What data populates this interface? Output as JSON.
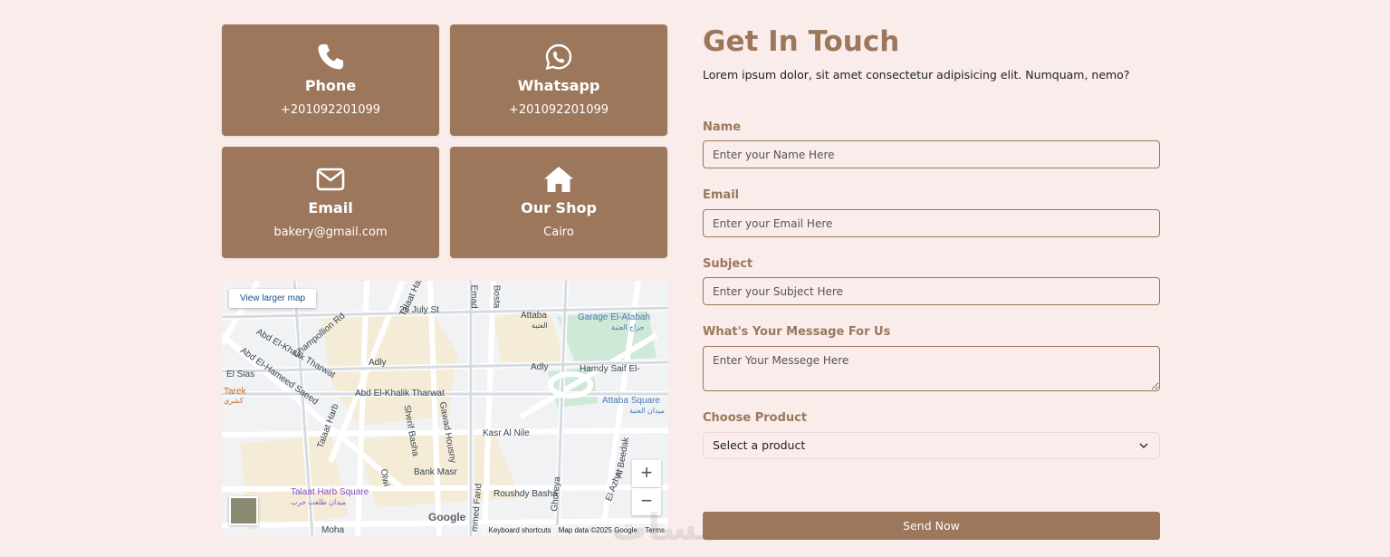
{
  "cards": [
    {
      "icon": "phone-icon",
      "title": "Phone",
      "value": "+201092201099"
    },
    {
      "icon": "whatsapp-icon",
      "title": "Whatsapp",
      "value": "+201092201099"
    },
    {
      "icon": "envelope-icon",
      "title": "Email",
      "value": "bakery@gmail.com"
    },
    {
      "icon": "home-icon",
      "title": "Our Shop",
      "value": "Cairo"
    }
  ],
  "map": {
    "view_larger": "View larger map",
    "zoom_in": "+",
    "zoom_out": "−",
    "logo": "Google",
    "attribution": {
      "shortcuts": "Keyboard shortcuts",
      "data": "Map data ©2025 Google",
      "terms": "Terms"
    },
    "labels": {
      "talaat_harb_top": "Talaat Harb",
      "july26": "26 July St",
      "emad": "Emad",
      "bosta": "Bosta",
      "attaba": "Attaba",
      "attaba_ar": "العتبة",
      "garage": "Garage El-Atabah",
      "garage_ar": "جراج العتبة",
      "champollion": "Champollion Rd",
      "abd_khalik_top": "Abd El-Khalik Tharwat",
      "abd_hameed": "Abd El-Hameed Saeed",
      "el_sias": "El Sias",
      "adly_left": "Adly",
      "adly_right": "Adly",
      "hamdy": "Hamdy Saif El-",
      "tarek": "Tarek",
      "tarek_ar": "كشري",
      "abd_khalik_mid": "Abd El-Khalik Tharwat",
      "attaba_square": "Attaba Square",
      "attaba_square_ar": "ميدان العتبة",
      "talaat_harb_mid": "Talaat Harb",
      "sherif_basha": "Sherif Basha",
      "gawad_housny": "Gawad Housny",
      "kasr_al_nile": "Kasr Al Nile",
      "bank_masr": "Bank Masr",
      "olwi": "Olwi",
      "el_azhar": "El Azhar",
      "el_beedak": "Al Beedak",
      "talaat_harb_square": "Talaat Harb Square",
      "talaat_harb_square_ar": "ميدان طلعت حرب",
      "mohamed_farid": "mmed Farid",
      "roushdy": "Roushdy Basha",
      "ghoreya": "Ghoreya",
      "moha": "Moha"
    }
  },
  "contact": {
    "title": "Get In Touch",
    "lead": "Lorem ipsum dolor, sit amet consectetur adipisicing elit. Numquam, nemo?",
    "fields": {
      "name_label": "Name",
      "name_placeholder": "Enter your Name Here",
      "email_label": "Email",
      "email_placeholder": "Enter your Email Here",
      "subject_label": "Subject",
      "subject_placeholder": "Enter your Subject Here",
      "message_label": "What's Your Message For Us",
      "message_placeholder": "Enter Your Messege Here",
      "product_label": "Choose Product",
      "product_selected": "Select a product"
    },
    "send_label": "Send Now"
  },
  "colors": {
    "accent": "#9c775c",
    "background": "#f9ecea"
  },
  "watermark": "خمسات"
}
